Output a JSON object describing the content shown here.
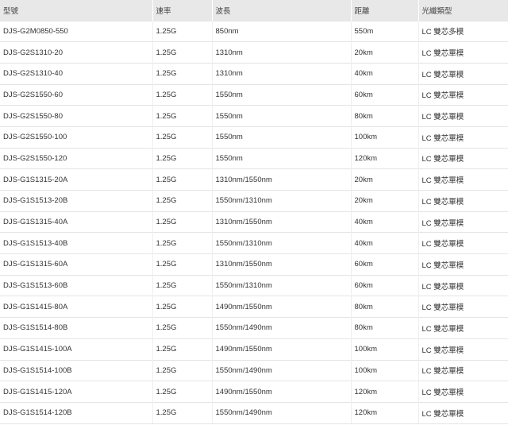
{
  "table": {
    "headers": [
      "型號",
      "速率",
      "波長",
      "距離",
      "光纖類型"
    ],
    "rows": [
      [
        "DJS-G2M0850-550",
        "1.25G",
        "850nm",
        "550m",
        "LC 雙芯多模"
      ],
      [
        "DJS-G2S1310-20",
        "1.25G",
        "1310nm",
        "20km",
        "LC 雙芯單模"
      ],
      [
        "DJS-G2S1310-40",
        "1.25G",
        "1310nm",
        "40km",
        "LC 雙芯單模"
      ],
      [
        "DJS-G2S1550-60",
        "1.25G",
        "1550nm",
        "60km",
        "LC 雙芯單模"
      ],
      [
        "DJS-G2S1550-80",
        "1.25G",
        "1550nm",
        "80km",
        "LC 雙芯單模"
      ],
      [
        "DJS-G2S1550-100",
        "1.25G",
        "1550nm",
        "100km",
        "LC 雙芯單模"
      ],
      [
        "DJS-G2S1550-120",
        "1.25G",
        "1550nm",
        "120km",
        "LC 雙芯單模"
      ],
      [
        "DJS-G1S1315-20A",
        "1.25G",
        "1310nm/1550nm",
        "20km",
        "LC 雙芯單模"
      ],
      [
        "DJS-G1S1513-20B",
        "1.25G",
        "1550nm/1310nm",
        "20km",
        "LC 雙芯單模"
      ],
      [
        "DJS-G1S1315-40A",
        "1.25G",
        "1310nm/1550nm",
        "40km",
        "LC 雙芯單模"
      ],
      [
        "DJS-G1S1513-40B",
        "1.25G",
        "1550nm/1310nm",
        "40km",
        "LC 雙芯單模"
      ],
      [
        "DJS-G1S1315-60A",
        "1.25G",
        "1310nm/1550nm",
        "60km",
        "LC 雙芯單模"
      ],
      [
        "DJS-G1S1513-60B",
        "1.25G",
        "1550nm/1310nm",
        "60km",
        "LC 雙芯單模"
      ],
      [
        "DJS-G1S1415-80A",
        "1.25G",
        "1490nm/1550nm",
        "80km",
        "LC 雙芯單模"
      ],
      [
        "DJS-G1S1514-80B",
        "1.25G",
        "1550nm/1490nm",
        "80km",
        "LC 雙芯單模"
      ],
      [
        "DJS-G1S1415-100A",
        "1.25G",
        "1490nm/1550nm",
        "100km",
        "LC 雙芯單模"
      ],
      [
        "DJS-G1S1514-100B",
        "1.25G",
        "1550nm/1490nm",
        "100km",
        "LC 雙芯單模"
      ],
      [
        "DJS-G1S1415-120A",
        "1.25G",
        "1490nm/1550nm",
        "120km",
        "LC 雙芯單模"
      ],
      [
        "DJS-G1S1514-120B",
        "1.25G",
        "1550nm/1490nm",
        "120km",
        "LC 雙芯單模"
      ]
    ]
  }
}
